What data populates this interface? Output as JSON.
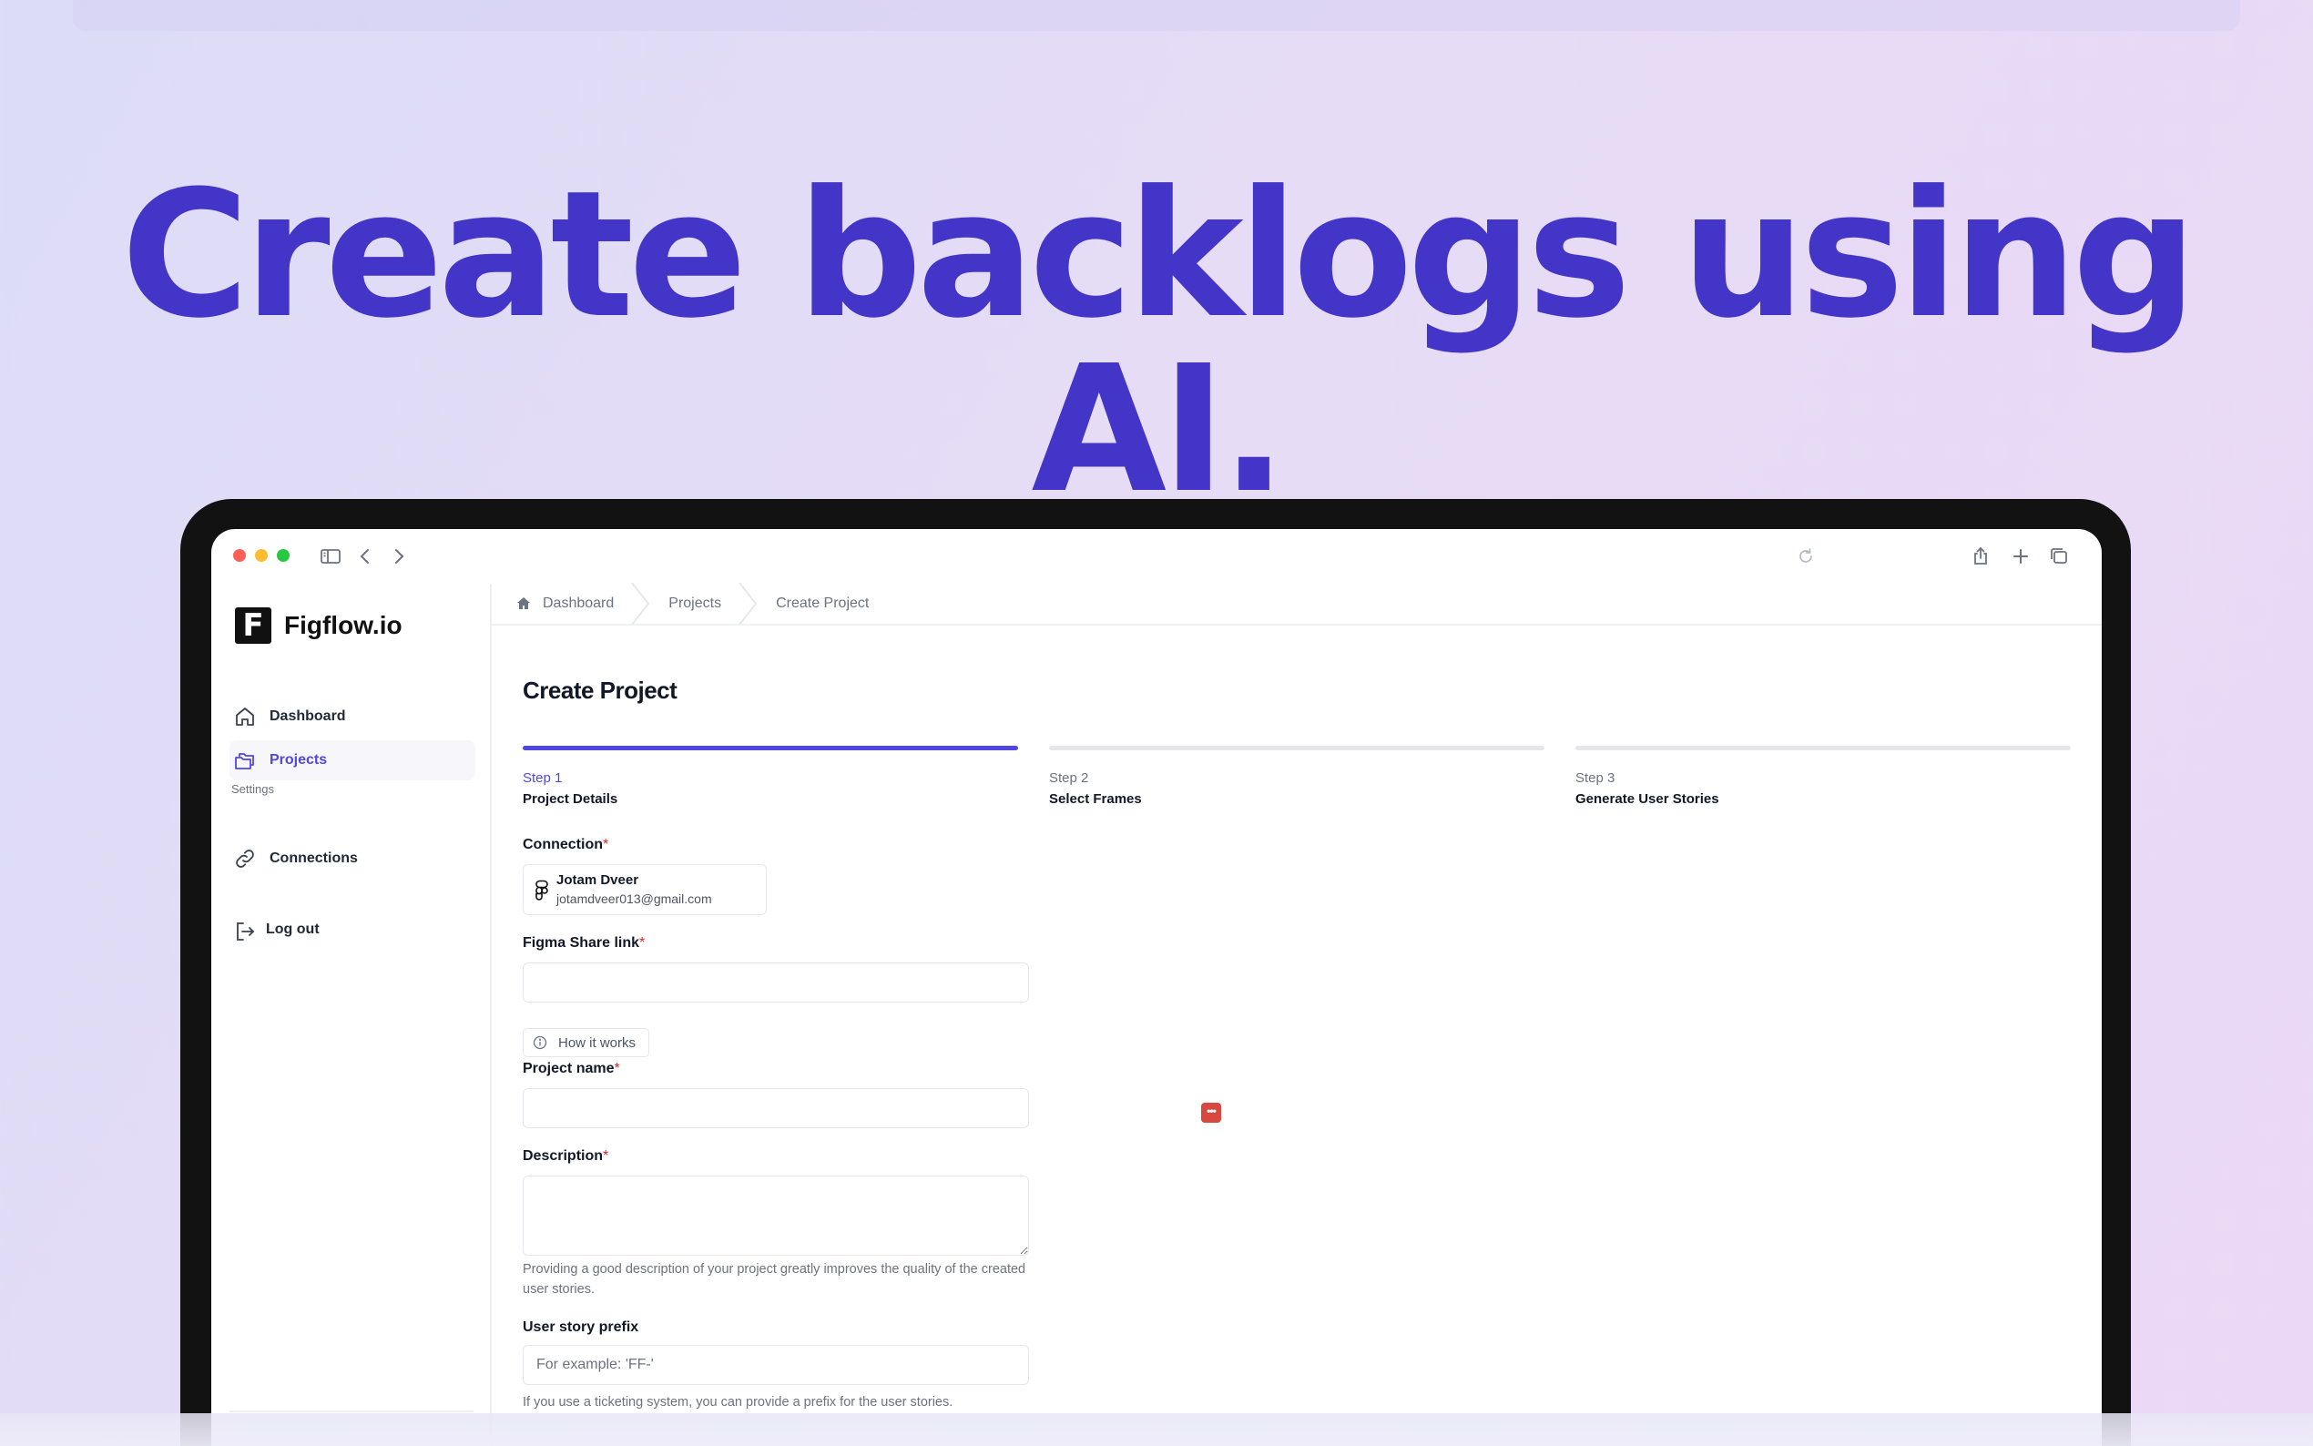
{
  "headline": "Create backlogs using AI.",
  "colors": {
    "accent": "#4f46e5",
    "headline": "#4435c9",
    "required": "#dc2626"
  },
  "toolbar": {
    "icons": [
      "sidebar-toggle-icon",
      "back-icon",
      "forward-icon",
      "reload-icon",
      "share-icon",
      "new-tab-icon",
      "tabs-overview-icon"
    ]
  },
  "sidebar": {
    "logo_mark": "F",
    "logo_text": "Figflow.io",
    "items": [
      {
        "label": "Dashboard",
        "icon": "home-icon"
      },
      {
        "label": "Projects",
        "icon": "folders-icon",
        "active": true
      }
    ],
    "settings_label": "Settings",
    "settings_items": [
      {
        "label": "Connections",
        "icon": "link-icon"
      }
    ],
    "logout_label": "Log out"
  },
  "breadcrumb": [
    "Dashboard",
    "Projects",
    "Create Project"
  ],
  "page": {
    "title": "Create Project",
    "steps": [
      {
        "num": "Step 1",
        "name": "Project Details",
        "active": true
      },
      {
        "num": "Step 2",
        "name": "Select Frames",
        "active": false
      },
      {
        "num": "Step 3",
        "name": "Generate User Stories",
        "active": false
      }
    ],
    "form": {
      "connection_label": "Connection",
      "connection_name": "Jotam Dveer",
      "connection_email": "jotamdveer013@gmail.com",
      "figma_label": "Figma Share link",
      "figma_value": "",
      "howto_label": "How it works",
      "project_name_label": "Project name",
      "project_name_value": "",
      "description_label": "Description",
      "description_value": "",
      "description_help": "Providing a good description of your project greatly improves the quality of the created user stories.",
      "prefix_label": "User story prefix",
      "prefix_placeholder": "For example: 'FF-'",
      "prefix_help": "If you use a ticketing system, you can provide a prefix for the user stories.",
      "required_mark": "*",
      "password_manager_glyph": "•••"
    }
  }
}
